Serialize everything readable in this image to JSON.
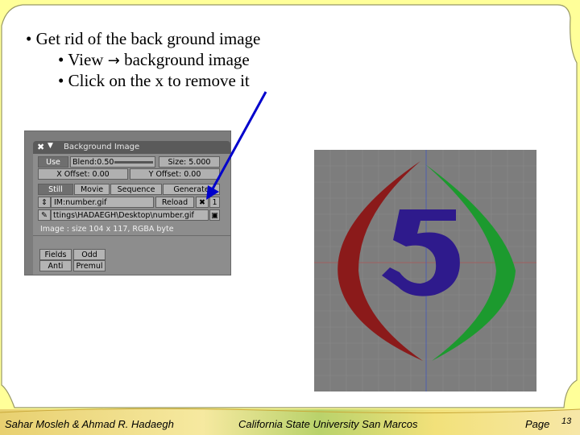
{
  "slide": {
    "bullet1": "Get rid of the back ground image",
    "bullet2_pre": "View",
    "bullet2_post": "background image",
    "bullet3": "Click on the x to remove it",
    "bullet_char": "•",
    "arrow_char": "→"
  },
  "panel": {
    "close_glyph": "✖",
    "collapse_glyph": "▼",
    "title": "Background Image",
    "use_label": "Use",
    "blend_label": "Blend:0.50",
    "size_label": "Size: 5.000",
    "x_offset_label": "X Offset: 0.00",
    "y_offset_label": "Y Offset: 0.00",
    "tabs": [
      "Still",
      "Movie",
      "Sequence",
      "Generate"
    ],
    "image_name": "IM:number.gif",
    "reload_label": "Reload",
    "remove_glyph": "✖",
    "user_count": "1",
    "file_path": "ttings\\HADAEGH\\Desktop\\number.gif",
    "image_info": "Image : size 104 x 117, RGBA byte",
    "fields_label": "Fields",
    "odd_label": "Odd",
    "anti_label": "Anti",
    "premul_label": "Premul"
  },
  "footer": {
    "authors": "Sahar Mosleh & Ahmad R. Hadaegh",
    "institution": "California State University San Marcos",
    "page_label": "Page",
    "page_number": "13"
  },
  "colors": {
    "frame_yellow": "#ffff99",
    "frame_border": "#999966",
    "arrow_blue": "#0000cc",
    "preview_bg": "#7d7d7d",
    "shape_red": "#8b1a1a",
    "shape_green": "#1c9a2e",
    "digit_blue": "#2e1a8c"
  }
}
